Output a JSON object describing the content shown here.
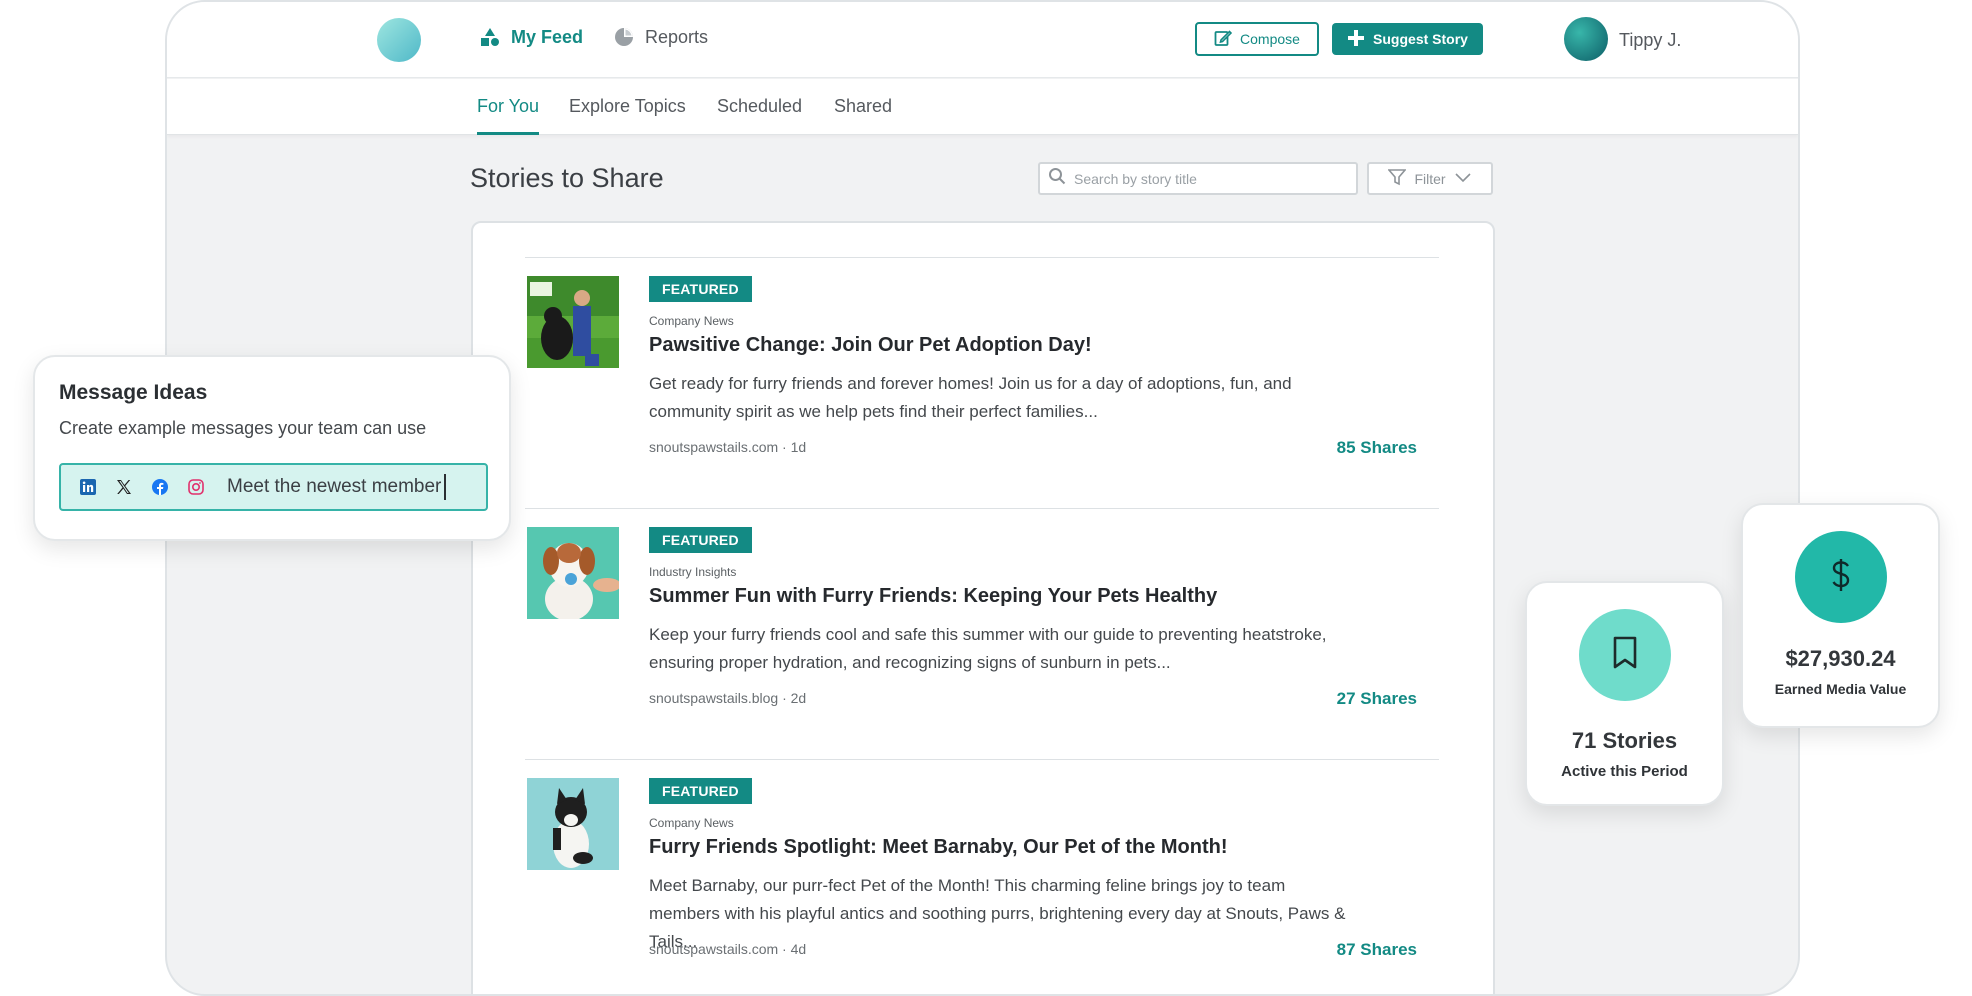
{
  "header": {
    "nav": [
      {
        "label": "My Feed",
        "icon": "shapes-icon",
        "active": true
      },
      {
        "label": "Reports",
        "icon": "pie-chart-icon",
        "active": false
      }
    ],
    "compose_label": "Compose",
    "suggest_label": "Suggest Story",
    "user_name": "Tippy J."
  },
  "tabs": [
    {
      "label": "For You",
      "active": true
    },
    {
      "label": "Explore Topics",
      "active": false
    },
    {
      "label": "Scheduled",
      "active": false
    },
    {
      "label": "Shared",
      "active": false
    }
  ],
  "main": {
    "title": "Stories to Share",
    "search_placeholder": "Search by story title",
    "filter_label": "Filter"
  },
  "stories": [
    {
      "badge": "FEATURED",
      "category": "Company News",
      "title": "Pawsitive Change: Join Our Pet Adoption Day!",
      "excerpt": "Get ready for furry friends and forever homes! Join us for a day of adoptions, fun, and community spirit as we help pets find their perfect families...",
      "source": "snoutspawstails.com · 1d",
      "shares": "85 Shares"
    },
    {
      "badge": "FEATURED",
      "category": "Industry Insights",
      "title": "Summer Fun with Furry Friends: Keeping Your Pets Healthy",
      "excerpt": "Keep your furry friends cool and safe this summer with our guide to preventing heatstroke, ensuring proper hydration, and recognizing signs of sunburn in pets...",
      "source": "snoutspawstails.blog · 2d",
      "shares": "27 Shares"
    },
    {
      "badge": "FEATURED",
      "category": "Company News",
      "title": "Furry Friends Spotlight: Meet Barnaby, Our Pet of the Month!",
      "excerpt": "Meet Barnaby, our purr-fect Pet of the Month! This charming feline brings joy to team members with his playful antics and soothing purrs, brightening every day at Snouts, Paws & Tails...",
      "source": "snoutspawstails.com · 4d",
      "shares": "87 Shares"
    }
  ],
  "message_ideas": {
    "title": "Message Ideas",
    "subtitle": "Create example messages your team can use",
    "input_value": "Meet the newest member",
    "socials": [
      "linkedin-icon",
      "x-icon",
      "facebook-icon",
      "instagram-icon"
    ]
  },
  "stats": {
    "stories_count": "71 Stories",
    "stories_label": "Active this Period",
    "value_amount": "$27,930.24",
    "value_label": "Earned Media Value"
  },
  "colors": {
    "accent": "#138a84",
    "accent_light": "#d6f3ef",
    "stat_circle_light": "#6fdccb",
    "stat_circle_dark": "#22b8a8"
  }
}
